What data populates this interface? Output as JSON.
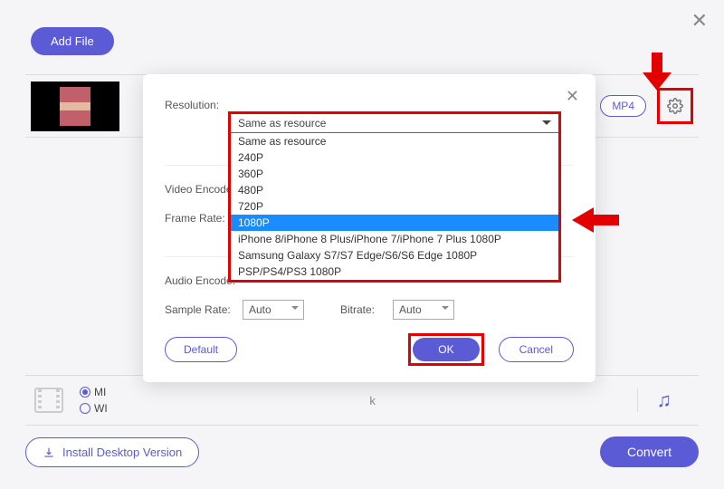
{
  "main_close": "✕",
  "add_file_label": "Add File",
  "format_badge": "MP4",
  "k_text": "k",
  "install_label": "Install Desktop Version",
  "convert_label": "Convert",
  "radio_opts": [
    "MI",
    "WI"
  ],
  "modal": {
    "close": "✕",
    "labels": {
      "resolution": "Resolution:",
      "video_encoder": "Video Encode:",
      "frame_rate": "Frame Rate:",
      "audio_encoder": "Audio Encode:",
      "sample_rate": "Sample Rate:",
      "bitrate": "Bitrate:"
    },
    "auto": "Auto",
    "default_btn": "Default",
    "ok_btn": "OK",
    "cancel_btn": "Cancel"
  },
  "dropdown": {
    "selected": "Same as resource",
    "options": [
      "Same as resource",
      "240P",
      "360P",
      "480P",
      "720P",
      "1080P",
      "iPhone 8/iPhone 8 Plus/iPhone 7/iPhone 7 Plus 1080P",
      "Samsung Galaxy S7/S7 Edge/S6/S6 Edge 1080P",
      "PSP/PS4/PS3 1080P"
    ],
    "highlighted_index": 5
  }
}
